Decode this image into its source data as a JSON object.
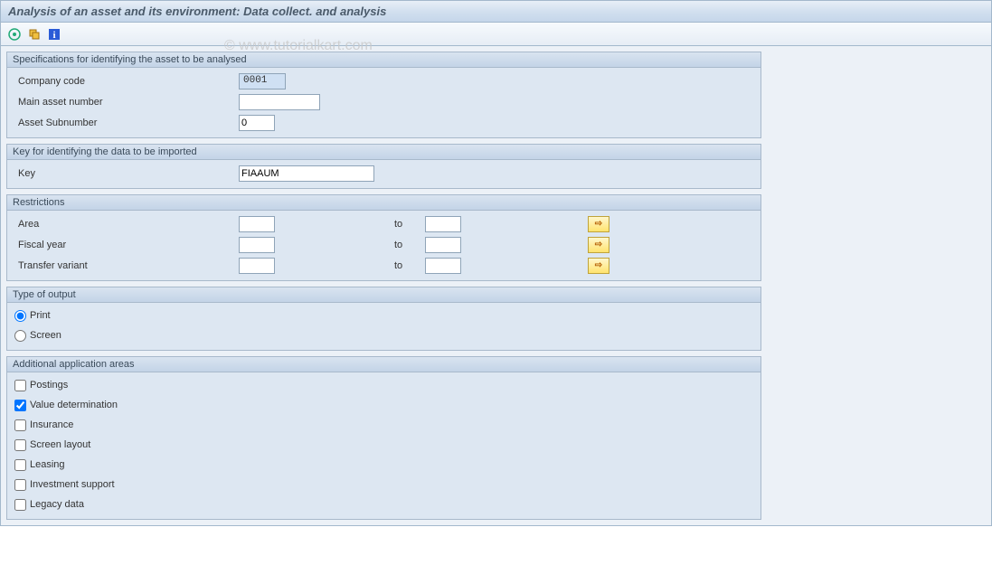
{
  "title": "Analysis of an asset and its environment: Data collect. and analysis",
  "watermark": "© www.tutorialkart.com",
  "toolbar": {
    "execute_icon": "execute",
    "variant_icon": "variant",
    "info_icon": "info"
  },
  "groups": {
    "spec": {
      "title": "Specifications for identifying the asset to be analysed",
      "company_code_label": "Company code",
      "company_code_value": "0001",
      "main_asset_label": "Main asset number",
      "main_asset_value": "",
      "subnumber_label": "Asset Subnumber",
      "subnumber_value": "0"
    },
    "key": {
      "title": "Key for identifying the data to be imported",
      "key_label": "Key",
      "key_value": "FIAAUM"
    },
    "restrict": {
      "title": "Restrictions",
      "to_label": "to",
      "area_label": "Area",
      "area_from": "",
      "area_to": "",
      "fiscal_label": "Fiscal year",
      "fiscal_from": "",
      "fiscal_to": "",
      "transfer_label": "Transfer variant",
      "transfer_from": "",
      "transfer_to": ""
    },
    "output": {
      "title": "Type of output",
      "print_label": "Print",
      "screen_label": "Screen",
      "selected": "print"
    },
    "areas": {
      "title": "Additional application areas",
      "items": [
        {
          "label": "Postings",
          "checked": false
        },
        {
          "label": "Value determination",
          "checked": true
        },
        {
          "label": "Insurance",
          "checked": false
        },
        {
          "label": "Screen layout",
          "checked": false
        },
        {
          "label": "Leasing",
          "checked": false
        },
        {
          "label": "Investment support",
          "checked": false
        },
        {
          "label": "Legacy data",
          "checked": false
        }
      ]
    }
  }
}
